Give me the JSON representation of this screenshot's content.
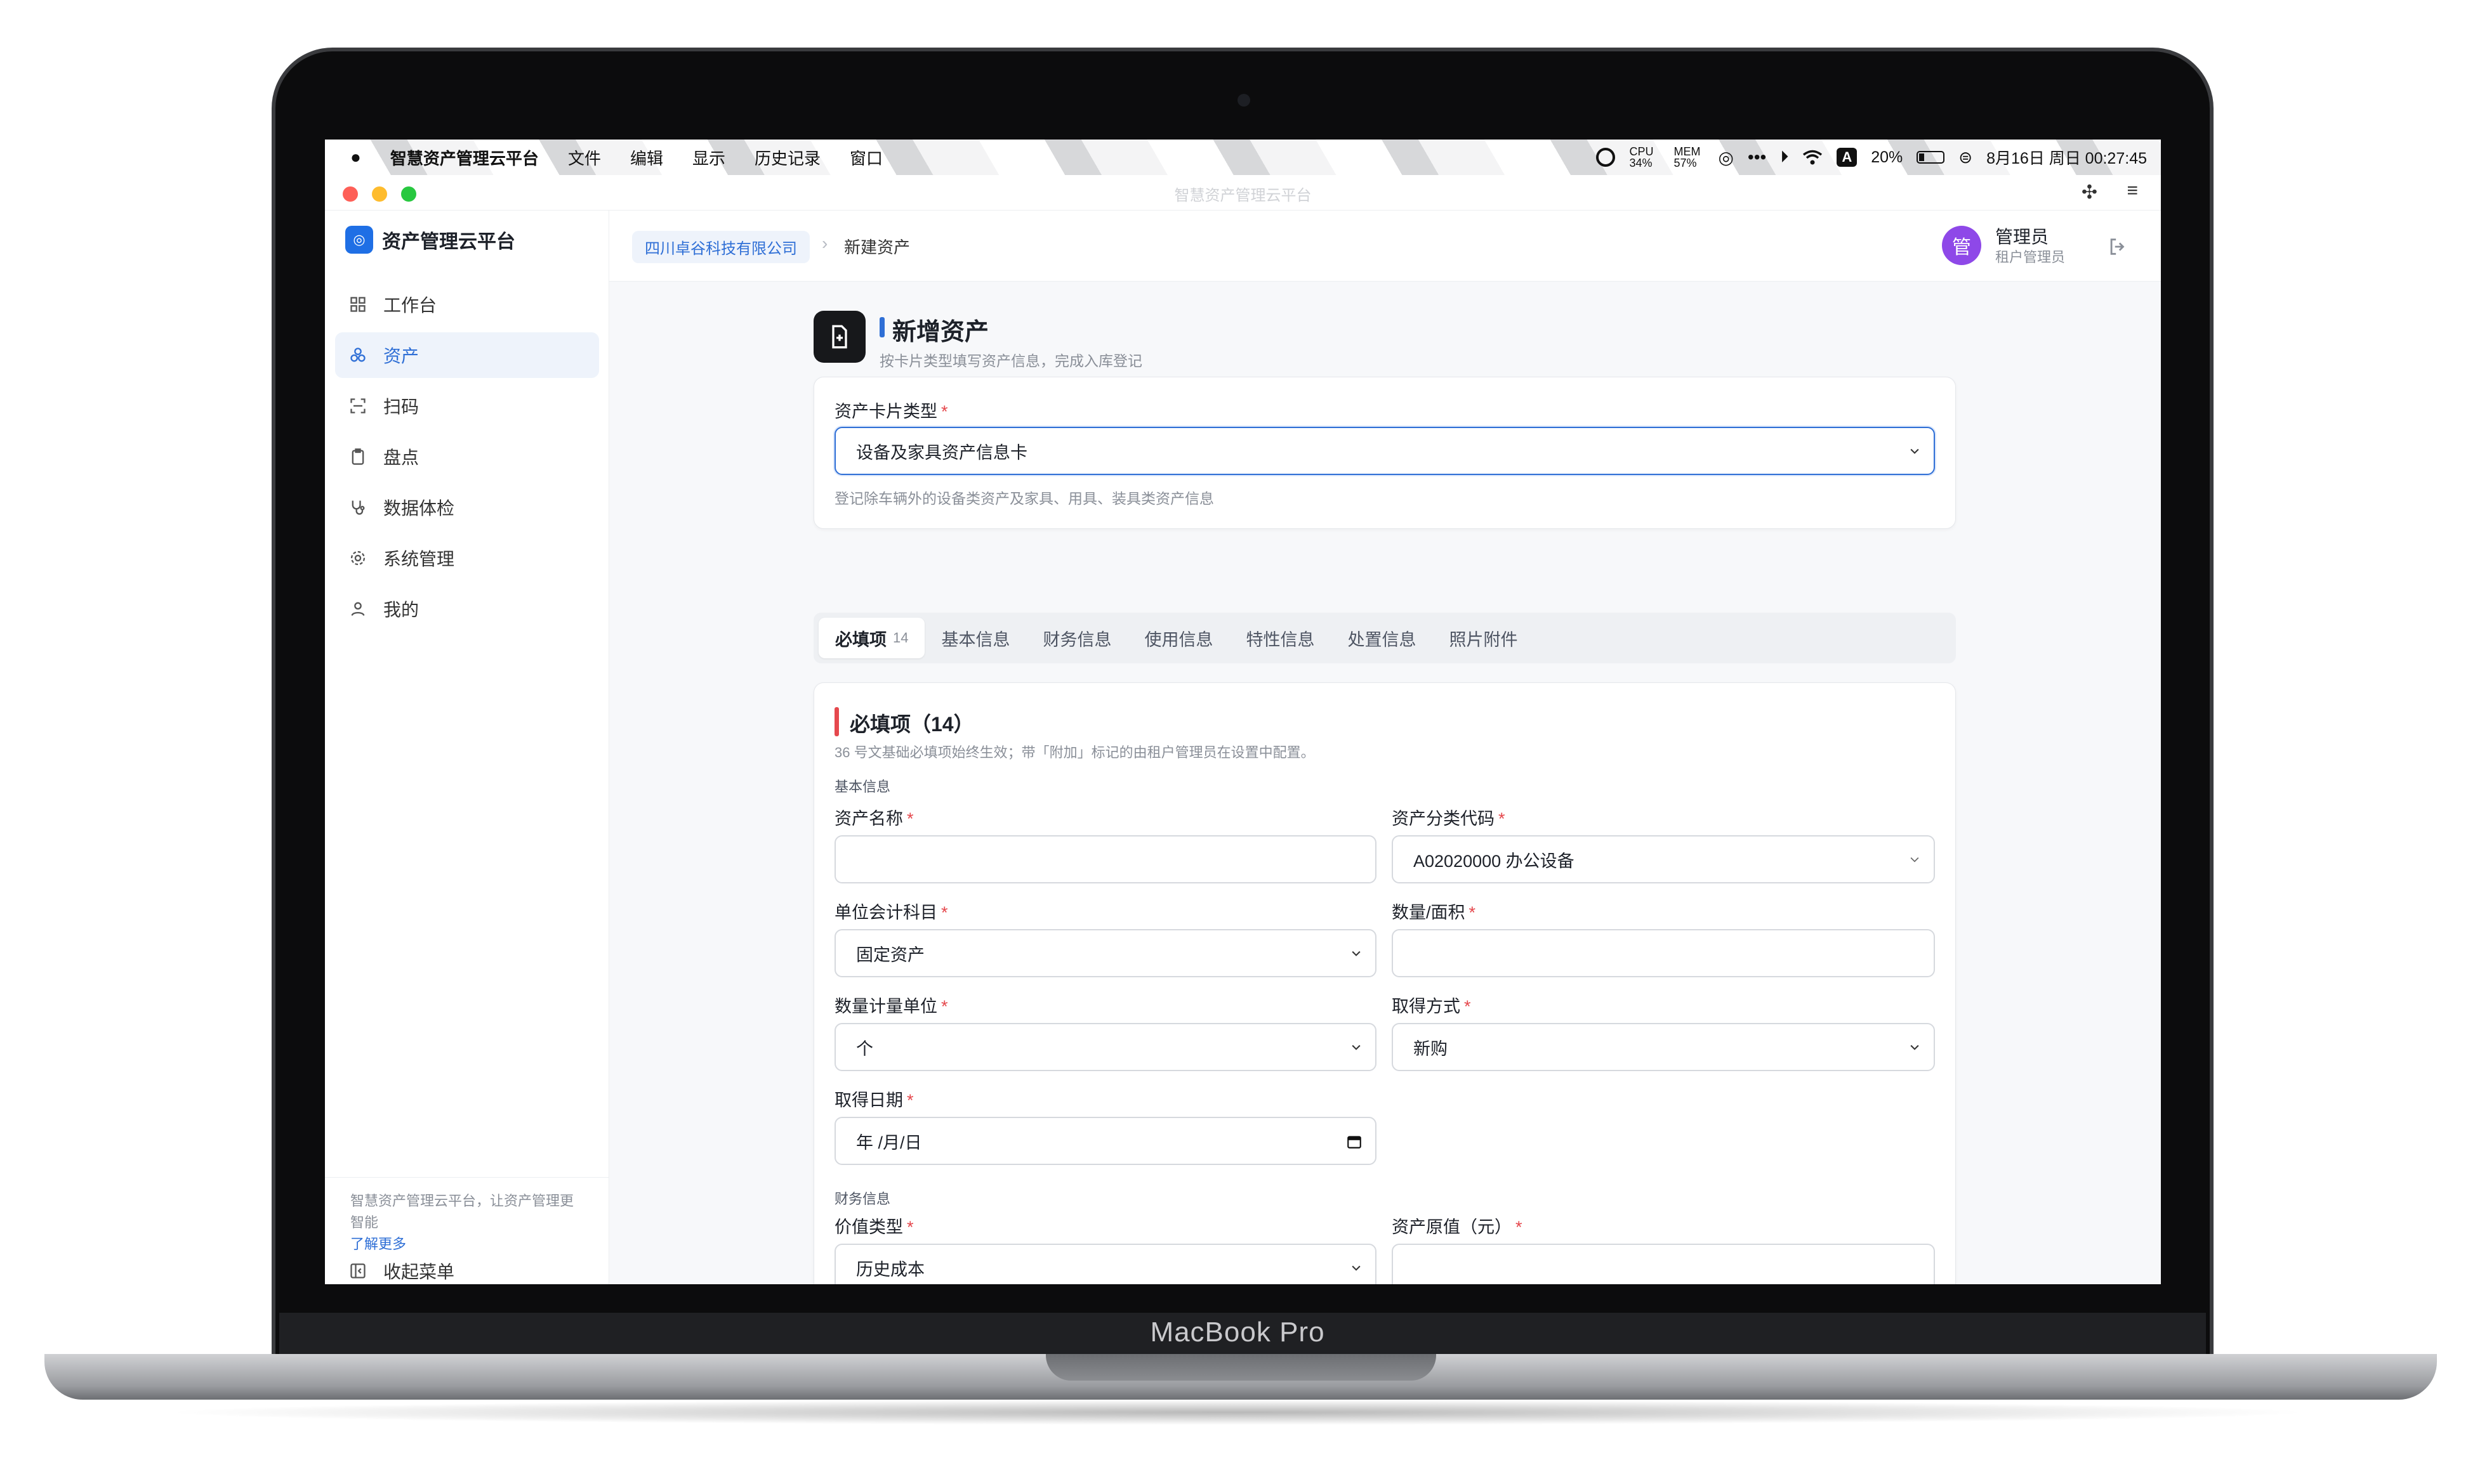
{
  "device": {
    "brand": "MacBook Pro"
  },
  "menubar": {
    "app_name": "智慧资产管理云平台",
    "menus": [
      "文件",
      "编辑",
      "显示",
      "历史记录",
      "窗口"
    ],
    "cpu": "CPU 34%",
    "mem": "MEM 57%",
    "input_method": "A",
    "battery": "20%",
    "datetime": "8月16日 周日  00:27:45"
  },
  "window": {
    "title": "智慧资产管理云平台"
  },
  "sidebar": {
    "brand": "资产管理云平台",
    "items": [
      {
        "label": "工作台",
        "icon": "dashboard-icon"
      },
      {
        "label": "资产",
        "icon": "assets-icon",
        "active": true
      },
      {
        "label": "扫码",
        "icon": "scan-icon"
      },
      {
        "label": "盘点",
        "icon": "clipboard-icon"
      },
      {
        "label": "数据体检",
        "icon": "stethoscope-icon"
      },
      {
        "label": "系统管理",
        "icon": "gear-icon"
      },
      {
        "label": "我的",
        "icon": "user-icon"
      }
    ],
    "footer_text": "智慧资产管理云平台，让资产管理更智能",
    "learn_more": "了解更多",
    "collapse": "收起菜单"
  },
  "header": {
    "org": "四川卓谷科技有限公司",
    "page": "新建资产",
    "avatar_char": "管",
    "user_name": "管理员",
    "user_role": "租户管理员"
  },
  "page": {
    "title": "新增资产",
    "subtitle": "按卡片类型填写资产信息，完成入库登记"
  },
  "card_type": {
    "label": "资产卡片类型",
    "value": "设备及家具资产信息卡",
    "hint": "登记除车辆外的设备类资产及家具、用具、装具类资产信息"
  },
  "tabs": [
    {
      "label": "必填项",
      "count": "14",
      "active": true
    },
    {
      "label": "基本信息"
    },
    {
      "label": "财务信息"
    },
    {
      "label": "使用信息"
    },
    {
      "label": "特性信息"
    },
    {
      "label": "处置信息"
    },
    {
      "label": "照片附件"
    }
  ],
  "required_section": {
    "title": "必填项（14）",
    "note": "36 号文基础必填项始终生效；带「附加」标记的由租户管理员在设置中配置。",
    "group_basic": "基本信息",
    "group_finance": "财务信息",
    "fields": {
      "asset_name": {
        "label": "资产名称",
        "value": ""
      },
      "category_code": {
        "label": "资产分类代码",
        "value": "A02020000 办公设备"
      },
      "account_subject": {
        "label": "单位会计科目",
        "value": "固定资产"
      },
      "quantity_area": {
        "label": "数量/面积",
        "value": ""
      },
      "unit": {
        "label": "数量计量单位",
        "value": "个"
      },
      "acquire_method": {
        "label": "取得方式",
        "value": "新购"
      },
      "acquire_date": {
        "label": "取得日期",
        "value": "年 /月/日"
      },
      "value_type": {
        "label": "价值类型",
        "value": "历史成本"
      },
      "original_value": {
        "label": "资产原值（元）",
        "value": ""
      }
    }
  },
  "colors": {
    "accent": "#2f6fd6",
    "required": "#e5484d",
    "avatar": "#8e48e8"
  }
}
